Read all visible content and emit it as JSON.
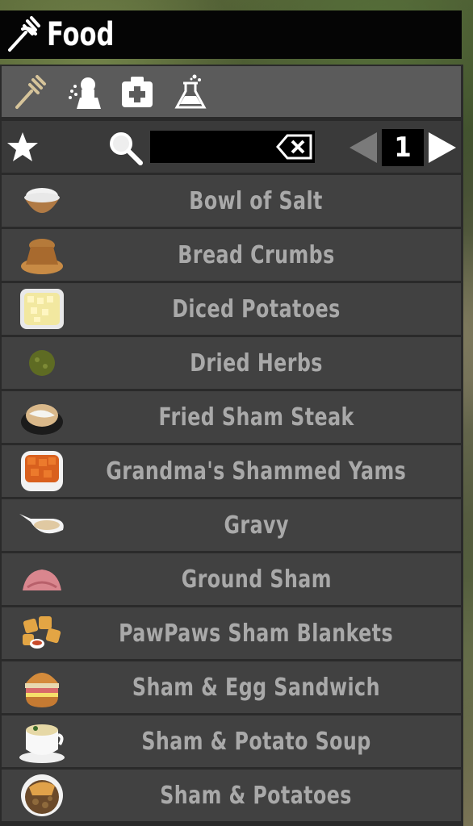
{
  "header": {
    "title": "Food",
    "icon": "fork-icon"
  },
  "categories": [
    {
      "name": "food-category-icon",
      "active": true
    },
    {
      "name": "medical-category-icon",
      "active": false
    },
    {
      "name": "first-aid-category-icon",
      "active": false
    },
    {
      "name": "chemistry-category-icon",
      "active": false
    }
  ],
  "toolbar": {
    "search_value": "",
    "page": "1"
  },
  "items": [
    {
      "label": "Bowl of Salt",
      "icon": "salt-bowl-icon"
    },
    {
      "label": "Bread Crumbs",
      "icon": "bread-crumbs-icon"
    },
    {
      "label": "Diced Potatoes",
      "icon": "diced-potatoes-icon"
    },
    {
      "label": "Dried Herbs",
      "icon": "dried-herbs-icon"
    },
    {
      "label": "Fried Sham Steak",
      "icon": "sham-steak-icon"
    },
    {
      "label": "Grandma's Shammed Yams",
      "icon": "shammed-yams-icon"
    },
    {
      "label": "Gravy",
      "icon": "gravy-icon"
    },
    {
      "label": "Ground Sham",
      "icon": "ground-sham-icon"
    },
    {
      "label": "PawPaws Sham Blankets",
      "icon": "sham-blankets-icon"
    },
    {
      "label": "Sham & Egg Sandwich",
      "icon": "sandwich-icon"
    },
    {
      "label": "Sham & Potato Soup",
      "icon": "soup-icon"
    },
    {
      "label": "Sham & Potatoes",
      "icon": "sham-potatoes-icon"
    }
  ],
  "colors": {
    "text": "#a9a9a9",
    "row": "#414141",
    "header": "#050505"
  }
}
